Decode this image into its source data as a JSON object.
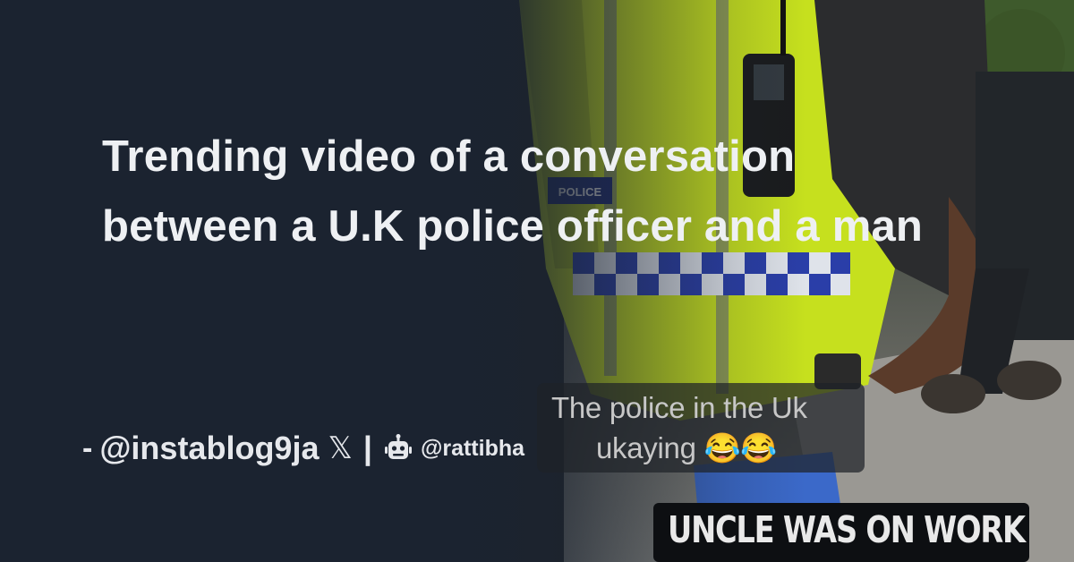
{
  "headline": "Trending video of a conversation between a U.K police officer and a man",
  "attribution": {
    "dash": "-",
    "handle": "@instablog9ja",
    "platform_icon": "x-logo-icon",
    "platform_glyph": "𝕏",
    "separator": "|",
    "bot_icon": "robot-icon",
    "site": "@rattibha"
  },
  "video_still": {
    "vest_label": "POLICE",
    "caption_line1": "The police in the Uk",
    "caption_line2": "ukaying 😂😂",
    "banner_text": "UNCLE WAS ON WORK"
  },
  "colors": {
    "background": "#1b2330",
    "text": "#eef0f3",
    "hi_vis": "#c6e01e",
    "checker_blue": "#2a3ea8"
  }
}
